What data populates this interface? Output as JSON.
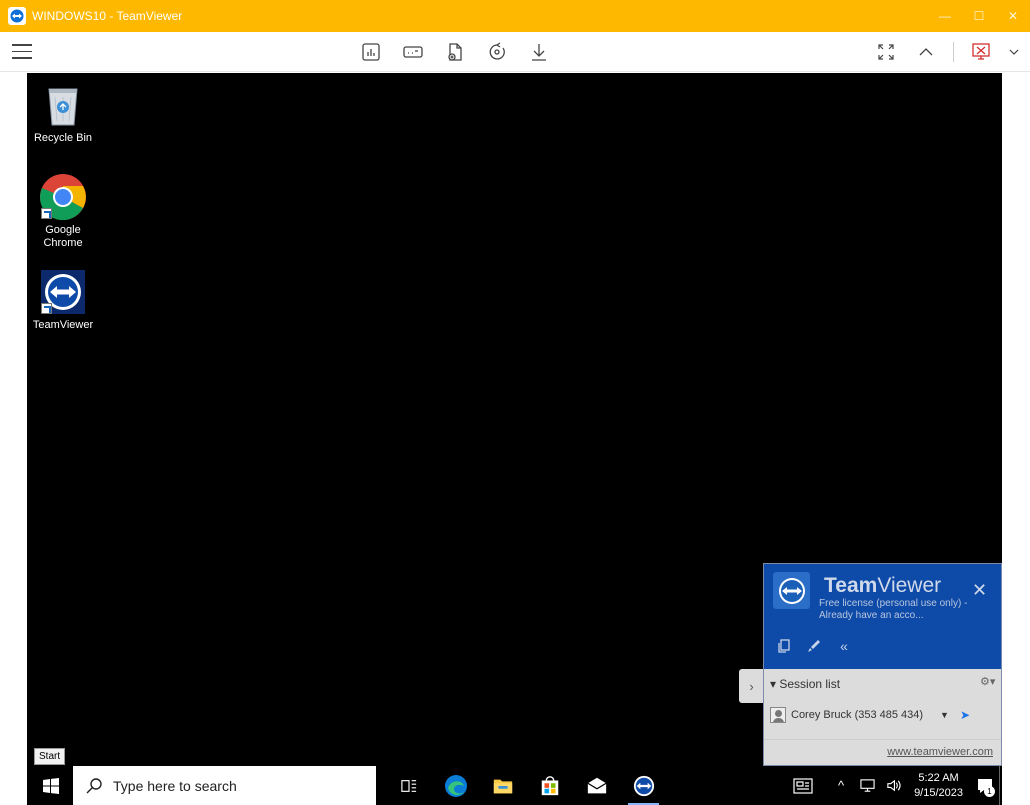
{
  "window": {
    "title": "WINDOWS10 - TeamViewer",
    "accent": "#ffb800"
  },
  "desktop": {
    "icons": [
      {
        "label": "Recycle Bin",
        "icon": "recycle-bin-icon"
      },
      {
        "label": "Google Chrome",
        "icon": "chrome-icon"
      },
      {
        "label": "TeamViewer",
        "icon": "teamviewer-icon"
      }
    ]
  },
  "tv_panel": {
    "brand_bold": "Team",
    "brand_light": "Viewer",
    "license_text": "Free license (personal use only) - Already have an acco...",
    "session_list_label": "Session list",
    "session_name": "Corey Bruck (353 485 434)",
    "link": "www.teamviewer.com"
  },
  "tooltip": "Start",
  "taskbar": {
    "search_placeholder": "Type here to search",
    "time": "5:22 AM",
    "date": "9/15/2023",
    "notification_count": "1"
  }
}
